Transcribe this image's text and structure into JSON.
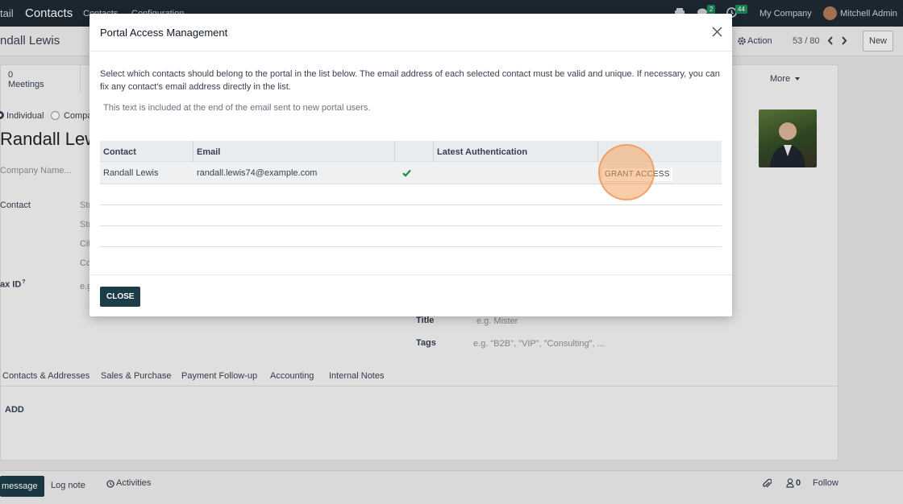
{
  "topbar": {
    "app_fragment": "tail",
    "app_name": "Contacts",
    "menu": [
      "Contacts",
      "Configuration"
    ],
    "chat_badge": "2",
    "activity_badge": "44",
    "company": "My Company",
    "user": "Mitchell Admin"
  },
  "control_panel": {
    "record_title": "ndall Lewis",
    "action_label": "Action",
    "pager": "53 / 80",
    "new_label": "New"
  },
  "form": {
    "meetings_count": "0",
    "meetings_label": "Meetings",
    "more_label": "More",
    "radio_individual": "Individual",
    "radio_company": "Compa",
    "name": "Randall Lewi",
    "company_placeholder": "Company Name...",
    "contact_label": "Contact",
    "address_fragments": [
      "Str",
      "Str",
      "Cit",
      "Co"
    ],
    "tax_label": "ax ID",
    "tax_placeholder": "e.g",
    "title_label": "Title",
    "title_placeholder": "e.g. Mister",
    "tags_label": "Tags",
    "tags_placeholder": "e.g. \"B2B\", \"VIP\", \"Consulting\", ...",
    "tabs": [
      "Contacts & Addresses",
      "Sales & Purchase",
      "Payment Follow-up",
      "Accounting",
      "Internal Notes"
    ],
    "add_label": "ADD"
  },
  "chatter": {
    "send_message": "message",
    "log_note": "Log note",
    "activities": "Activities",
    "followers_count": "0",
    "follow": "Follow"
  },
  "modal": {
    "title": "Portal Access Management",
    "description": "Select which contacts should belong to the portal in the list below. The email address of each selected contact must be valid and unique. If necessary, you can fix any contact's email address directly in the list.",
    "note": "This text is included at the end of the email sent to new portal users.",
    "columns": [
      "Contact",
      "Email",
      "Latest Authentication"
    ],
    "rows": [
      {
        "contact": "Randall Lewis",
        "email": "randall.lewis74@example.com",
        "action": "GRANT ACCESS"
      }
    ],
    "close_label": "CLOSE"
  },
  "colors": {
    "topbar": "#1e2a33",
    "primary_button": "#1c3c48",
    "check": "#1f8a3b",
    "click_highlight": "#f4a460"
  }
}
